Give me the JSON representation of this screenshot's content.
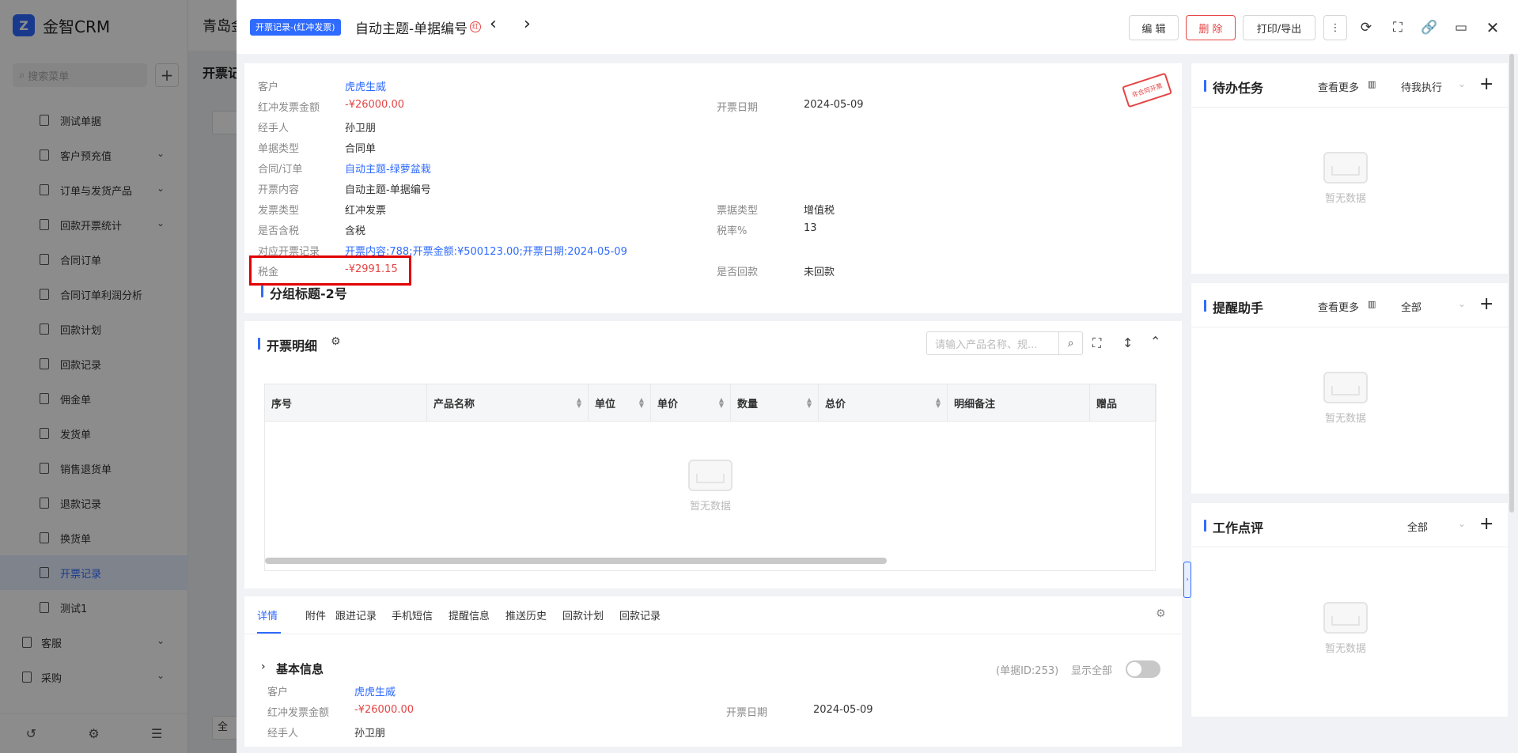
{
  "app": {
    "brand": "金智CRM",
    "company": "青岛金",
    "search_placeholder": "搜索菜单",
    "page_tab": "开票记",
    "menu": [
      {
        "label": "测试单据",
        "chev": false
      },
      {
        "label": "客户预充值",
        "chev": true
      },
      {
        "label": "订单与发货产品",
        "chev": true
      },
      {
        "label": "回款开票统计",
        "chev": true
      },
      {
        "label": "合同订单",
        "chev": false
      },
      {
        "label": "合同订单利润分析",
        "chev": false
      },
      {
        "label": "回款计划",
        "chev": false
      },
      {
        "label": "回款记录",
        "chev": false
      },
      {
        "label": "佣金单",
        "chev": false
      },
      {
        "label": "发货单",
        "chev": false
      },
      {
        "label": "销售退货单",
        "chev": false
      },
      {
        "label": "退款记录",
        "chev": false
      },
      {
        "label": "换货单",
        "chev": false
      },
      {
        "label": "开票记录",
        "chev": false,
        "active": true
      },
      {
        "label": "测试1",
        "chev": false
      }
    ],
    "groups": [
      {
        "label": "客服"
      },
      {
        "label": "采购"
      }
    ]
  },
  "header": {
    "tag": "开票记录-(红冲发票)",
    "title": "自动主题-单据编号",
    "red_mark": "红",
    "edit": "编 辑",
    "delete": "删 除",
    "print": "打印/导出"
  },
  "stamp": "非合同开票",
  "fields": {
    "customer_label": "客户",
    "customer": "虎虎生威",
    "amount_label": "红冲发票金额",
    "amount": "-¥26000.00",
    "date_label": "开票日期",
    "date": "2024-05-09",
    "handler_label": "经手人",
    "handler": "孙卫朋",
    "doc_type_label": "单据类型",
    "doc_type": "合同单",
    "contract_label": "合同/订单",
    "contract": "自动主题-绿萝盆栽",
    "content_label": "开票内容",
    "content": "自动主题-单据编号",
    "invoice_type_label": "发票类型",
    "invoice_type": "红冲发票",
    "bill_type_label": "票据类型",
    "bill_type": "增值税",
    "tax_included_label": "是否含税",
    "tax_included": "含税",
    "tax_rate_label": "税率%",
    "tax_rate": "13",
    "related_label": "对应开票记录",
    "related": "开票内容:788;开票金额:¥500123.00;开票日期:2024-05-09",
    "tax_label": "税金",
    "tax": "-¥2991.15",
    "paid_label": "是否回款",
    "paid": "未回款"
  },
  "group_title": "分组标题-2号",
  "detail": {
    "title": "开票明细",
    "search_placeholder": "请输入产品名称、规...",
    "columns": [
      "序号",
      "产品名称",
      "单位",
      "单价",
      "数量",
      "总价",
      "明细备注",
      "赠品"
    ],
    "empty": "暂无数据"
  },
  "bottom": {
    "tabs": [
      "详情",
      "附件",
      "跟进记录",
      "手机短信",
      "提醒信息",
      "推送历史",
      "回款计划",
      "回款记录"
    ],
    "section": "基本信息",
    "doc_id": "(单据ID:253)",
    "show_all": "显示全部"
  },
  "panels": [
    {
      "title": "待办任务",
      "more": "查看更多",
      "filter": "待我执行",
      "empty": "暂无数据"
    },
    {
      "title": "提醒助手",
      "more": "查看更多",
      "filter": "全部",
      "empty": "暂无数据"
    },
    {
      "title": "工作点评",
      "filter": "全部",
      "empty": "暂无数据"
    }
  ],
  "colors": {
    "accent": "#2f6bff",
    "danger": "#e54545",
    "highlight": "#e00000"
  },
  "bg_partial": "全"
}
